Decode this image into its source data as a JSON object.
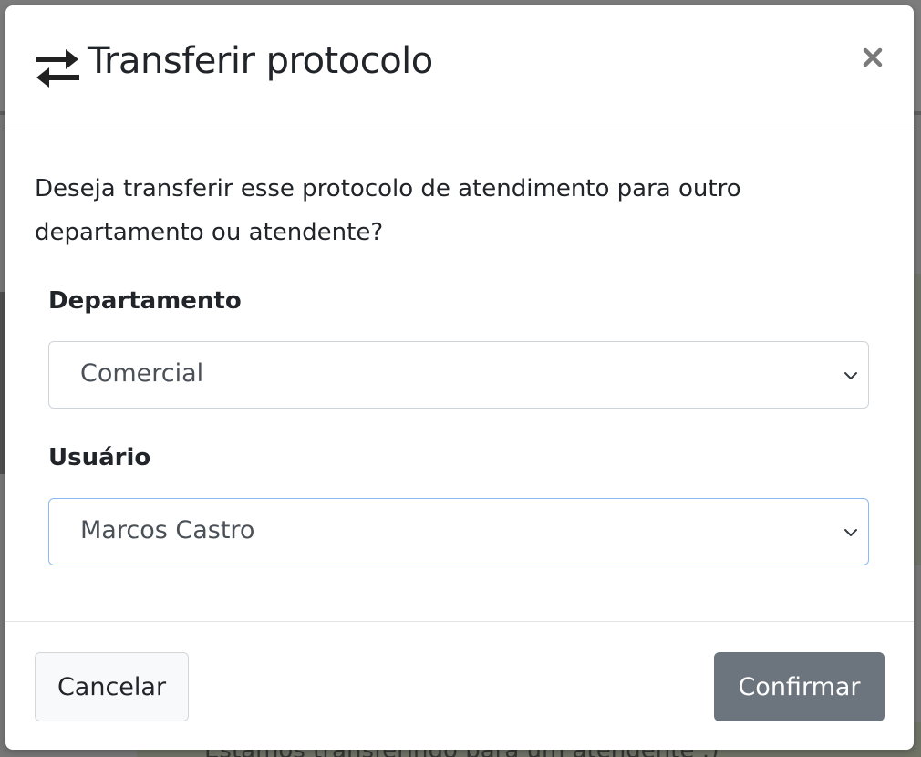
{
  "background": {
    "partial_text": "Estamos transferindo para um atendente :)"
  },
  "modal": {
    "title": "Transferir protocolo",
    "title_icon": "exchange-arrows-icon",
    "close_icon": "close-icon",
    "question": "Deseja transferir esse protocolo de atendimento para outro departamento ou atendente?",
    "department": {
      "label": "Departamento",
      "selected": "Comercial"
    },
    "user": {
      "label": "Usuário",
      "selected": "Marcos Castro"
    },
    "buttons": {
      "cancel": "Cancelar",
      "confirm": "Confirmar"
    }
  },
  "colors": {
    "confirm_button": "#6c757d",
    "focus_border": "#8bb9f2",
    "text": "#212529"
  }
}
